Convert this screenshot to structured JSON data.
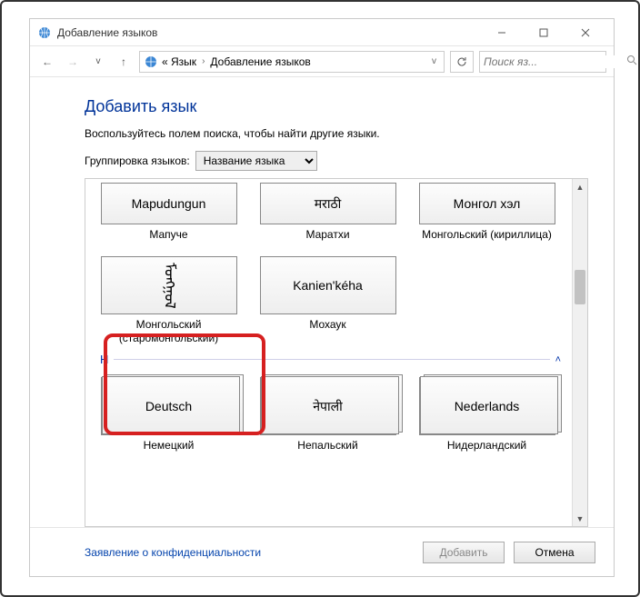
{
  "titlebar": {
    "title": "Добавление языков"
  },
  "nav": {
    "breadcrumb_root": "« Язык",
    "breadcrumb_page": "Добавление языков",
    "search_placeholder": "Поиск яз..."
  },
  "content": {
    "heading": "Добавить язык",
    "hint": "Воспользуйтесь полем поиска, чтобы найти другие языки.",
    "group_label": "Группировка языков:",
    "group_value": "Название языка"
  },
  "tiles_row1": [
    {
      "native": "Mapudungun",
      "name": "Мапуче"
    },
    {
      "native": "मराठी",
      "name": "Маратхи"
    },
    {
      "native": "Монгол хэл",
      "name": "Монгольский (кириллица)"
    }
  ],
  "tiles_row2": [
    {
      "native": "ᠮᠣᠩᠭᠣᠯ",
      "name": "Монгольский (старомонгольский)"
    },
    {
      "native": "Kanien'kéha",
      "name": "Мохаук"
    }
  ],
  "group_H": {
    "letter": "Н"
  },
  "tiles_row3": [
    {
      "native": "Deutsch",
      "name": "Немецкий"
    },
    {
      "native": "नेपाली",
      "name": "Непальский"
    },
    {
      "native": "Nederlands",
      "name": "Нидерландский"
    }
  ],
  "footer": {
    "privacy": "Заявление о конфиденциальности",
    "add": "Добавить",
    "cancel": "Отмена"
  }
}
